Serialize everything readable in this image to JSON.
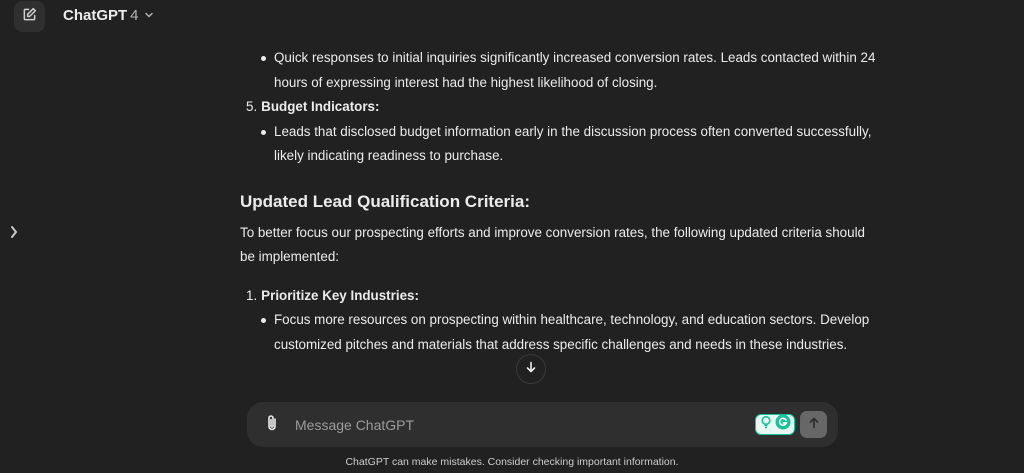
{
  "header": {
    "model_name": "ChatGPT",
    "model_version": "4"
  },
  "content": {
    "items": [
      {
        "type": "bullet",
        "text": "Quick responses to initial inquiries significantly increased conversion rates. Leads contacted within 24 hours of expressing interest had the highest likelihood of closing."
      },
      {
        "type": "numbered",
        "number": "5.",
        "text": "Budget Indicators:"
      },
      {
        "type": "bullet",
        "text": "Leads that disclosed budget information early in the discussion process often converted successfully, likely indicating readiness to purchase."
      }
    ],
    "section_title": "Updated Lead Qualification Criteria:",
    "intro": "To better focus our prospecting efforts and improve conversion rates, the following updated criteria should be implemented:",
    "items2": [
      {
        "type": "numbered",
        "number": "1.",
        "text": "Prioritize Key Industries:"
      },
      {
        "type": "bullet",
        "text": "Focus more resources on prospecting within healthcare, technology, and education sectors. Develop customized pitches and materials that address specific challenges and needs in these industries."
      }
    ]
  },
  "composer": {
    "placeholder": "Message ChatGPT"
  },
  "footer": {
    "disclaimer": "ChatGPT can make mistakes. Consider checking important information."
  },
  "icons": {
    "new_chat": "edit-icon",
    "sidebar_toggle": "chevron-right-icon",
    "scroll": "arrow-down-icon",
    "attach": "paperclip-icon",
    "send": "arrow-up-icon",
    "grammarly": "grammarly-icon"
  },
  "colors": {
    "background": "#212121",
    "composer": "#2f2f2f",
    "grammarly_green": "#15c39a"
  }
}
